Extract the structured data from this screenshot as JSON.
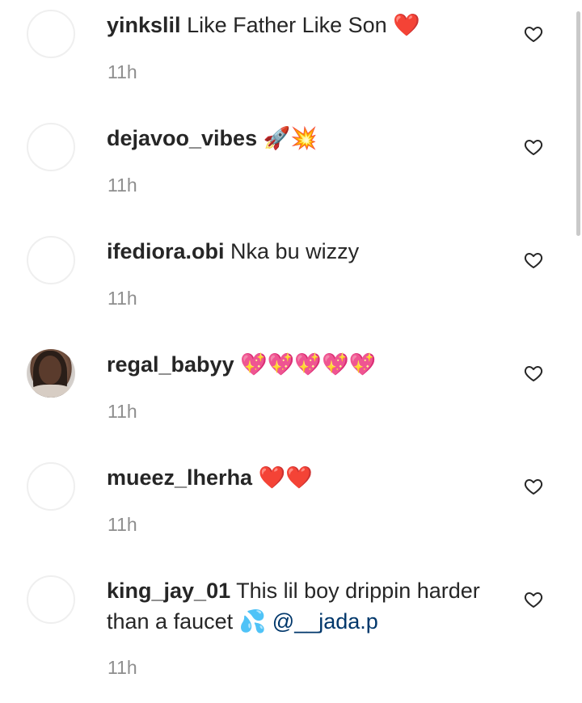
{
  "comments": [
    {
      "username": "yinkslil",
      "text": "Like Father Like Son",
      "emoji": "❤️",
      "time": "11h",
      "avatar": "placeholder"
    },
    {
      "username": "dejavoo_vibes",
      "text": "",
      "emoji": "🚀💥",
      "time": "11h",
      "avatar": "placeholder"
    },
    {
      "username": "ifediora.obi",
      "text": "Nka bu wizzy",
      "emoji": "",
      "time": "11h",
      "avatar": "placeholder"
    },
    {
      "username": "regal_babyy",
      "text": "",
      "emoji": "💖💖💖💖💖",
      "time": "11h",
      "avatar": "photo"
    },
    {
      "username": "mueez_lherha",
      "text": "",
      "emoji": "❤️❤️",
      "time": "11h",
      "avatar": "placeholder"
    },
    {
      "username": "king_jay_01",
      "text": "This lil boy drippin harder than a faucet",
      "emoji": "💦",
      "mention": "@__jada.p",
      "time": "11h",
      "avatar": "placeholder"
    }
  ],
  "icons": {
    "like": "heart-outline-icon"
  },
  "colors": {
    "text": "#262626",
    "secondary_text": "#8e8e8e",
    "mention": "#00376b",
    "avatar_border": "#efefef"
  }
}
